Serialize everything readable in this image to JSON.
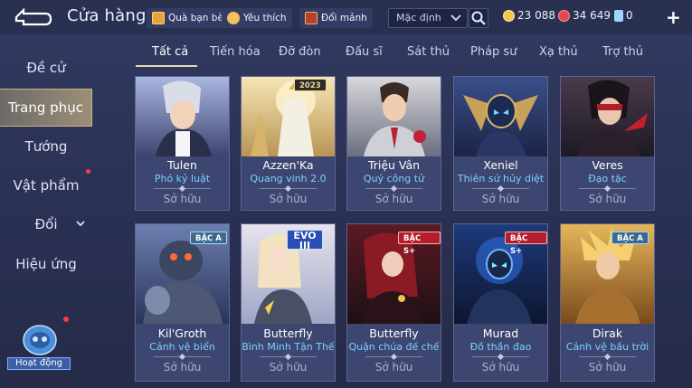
{
  "header": {
    "title": "Cửa hàng",
    "gift_label": "Quà bạn bè",
    "wish_label": "Yêu thích",
    "exchange_label": "Đổi mảnh",
    "sort_select": "Mặc định",
    "currency_gold": "23 088",
    "currency_ruby": "34 649",
    "currency_voucher": "0"
  },
  "sidebar": {
    "items": [
      {
        "label": "Đề cử"
      },
      {
        "label": "Trang phục"
      },
      {
        "label": "Tướng"
      },
      {
        "label": "Vật phẩm"
      },
      {
        "label": "Đổi"
      },
      {
        "label": "Hiệu ứng"
      }
    ],
    "event_label": "Hoạt động"
  },
  "tabs": [
    "Tất cả",
    "Tiến hóa",
    "Đỡ đòn",
    "Đấu sĩ",
    "Sát thủ",
    "Pháp sư",
    "Xạ thủ",
    "Trợ thủ"
  ],
  "cards": [
    {
      "hero": "Tulen",
      "skin": "Phó kỷ luật",
      "status": "Sở hữu",
      "badge": ""
    },
    {
      "hero": "Azzen'Ka",
      "skin": "Quang vinh 2.0",
      "status": "Sở hữu",
      "badge": "2023"
    },
    {
      "hero": "Triệu Vân",
      "skin": "Quý công tử",
      "status": "Sở hữu",
      "badge": ""
    },
    {
      "hero": "Xeniel",
      "skin": "Thiên sứ hủy diệt",
      "status": "Sở hữu",
      "badge": ""
    },
    {
      "hero": "Veres",
      "skin": "Đạo tặc",
      "status": "Sở hữu",
      "badge": ""
    },
    {
      "hero": "Kil'Groth",
      "skin": "Cảnh vệ biển",
      "status": "Sở hữu",
      "badge": "BẬC A"
    },
    {
      "hero": "Butterfly",
      "skin": "Bình Minh Tận Thế",
      "status": "Sở hữu",
      "badge": "EVO III"
    },
    {
      "hero": "Butterfly",
      "skin": "Quận chúa đế chế",
      "status": "Sở hữu",
      "badge": "BẬC S+"
    },
    {
      "hero": "Murad",
      "skin": "Đồ thần đao",
      "status": "Sở hữu",
      "badge": "BẬC S+"
    },
    {
      "hero": "Dirak",
      "skin": "Cảnh vệ bầu trời",
      "status": "Sở hữu",
      "badge": "BẬC A"
    }
  ],
  "colors": {
    "accent": "#e9d9b0",
    "skin_name": "#7ad0ff",
    "background": "#2b3152",
    "card_border": "#5a6594"
  }
}
